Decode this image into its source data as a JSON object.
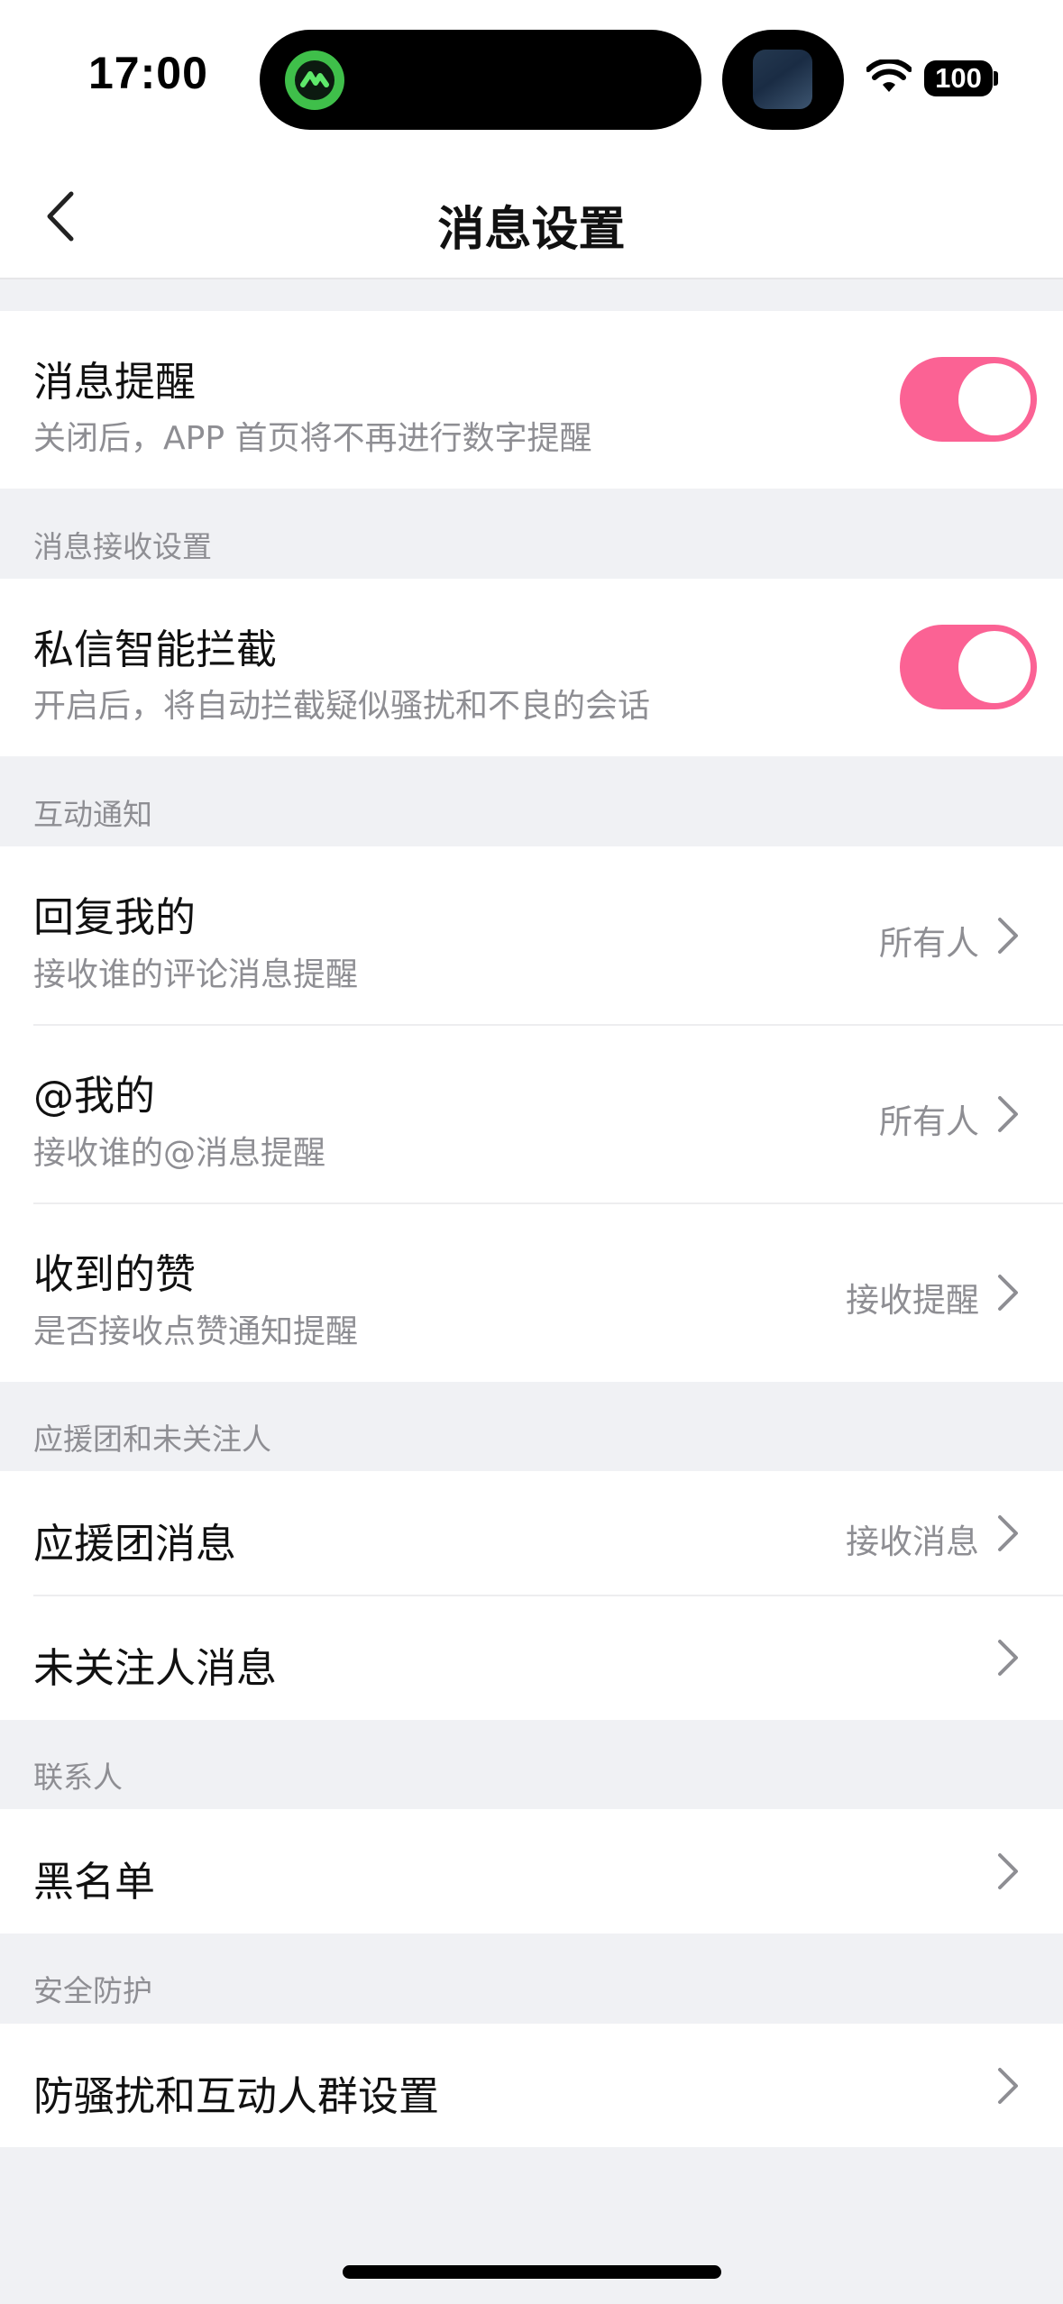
{
  "status_bar": {
    "time": "17:00",
    "battery": "100"
  },
  "nav": {
    "title": "消息设置"
  },
  "notify_section": {
    "title": "消息提醒",
    "subtitle": "关闭后，APP 首页将不再进行数字提醒",
    "toggle_on": true
  },
  "receive_section": {
    "header": "消息接收设置",
    "title": "私信智能拦截",
    "subtitle": "开启后，将自动拦截疑似骚扰和不良的会话",
    "toggle_on": true
  },
  "interaction_section": {
    "header": "互动通知",
    "rows": [
      {
        "title": "回复我的",
        "subtitle": "接收谁的评论消息提醒",
        "value": "所有人"
      },
      {
        "title": "@我的",
        "subtitle": "接收谁的@消息提醒",
        "value": "所有人"
      },
      {
        "title": "收到的赞",
        "subtitle": "是否接收点赞通知提醒",
        "value": "接收提醒"
      }
    ]
  },
  "fan_section": {
    "header": "应援团和未关注人",
    "rows": [
      {
        "title": "应援团消息",
        "value": "接收消息"
      },
      {
        "title": "未关注人消息",
        "value": ""
      }
    ]
  },
  "contacts_section": {
    "header": "联系人",
    "rows": [
      {
        "title": "黑名单"
      }
    ]
  },
  "safety_section": {
    "header": "安全防护",
    "rows": [
      {
        "title": "防骚扰和互动人群设置"
      }
    ]
  },
  "colors": {
    "accent": "#fb6294",
    "background": "#f0f1f4",
    "secondary_text": "#8e8e93"
  },
  "icons": {
    "back": "chevron-left-icon",
    "row_arrow": "chevron-right-icon",
    "wifi": "wifi-icon",
    "battery": "battery-icon"
  }
}
